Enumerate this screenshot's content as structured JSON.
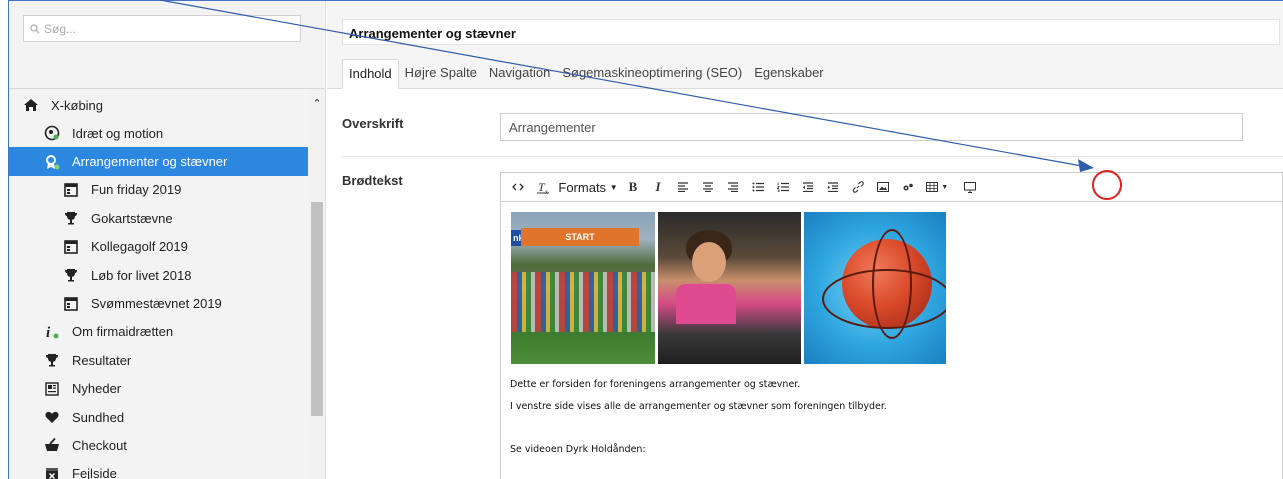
{
  "search": {
    "placeholder": "Søg..."
  },
  "tree": [
    {
      "label": "X-købing",
      "icon": "home-icon"
    },
    {
      "label": "Idræt og motion",
      "icon": "target-icon"
    },
    {
      "label": "Arrangementer og stævner",
      "icon": "award-icon",
      "selected": true
    },
    {
      "label": "Fun friday 2019",
      "icon": "calendar-icon"
    },
    {
      "label": "Gokartstævne",
      "icon": "trophy-icon"
    },
    {
      "label": "Kollegagolf 2019",
      "icon": "calendar-icon"
    },
    {
      "label": "Løb for livet 2018",
      "icon": "trophy-icon"
    },
    {
      "label": "Svømmestævnet 2019",
      "icon": "calendar-icon"
    },
    {
      "label": "Om firmaidrætten",
      "icon": "info-icon"
    },
    {
      "label": "Resultater",
      "icon": "trophy-icon"
    },
    {
      "label": "Nyheder",
      "icon": "newspaper-icon"
    },
    {
      "label": "Sundhed",
      "icon": "heart-icon"
    },
    {
      "label": "Checkout",
      "icon": "cart-icon"
    },
    {
      "label": "Fejlside",
      "icon": "error-icon"
    }
  ],
  "page": {
    "title": "Arrangementer og stævner"
  },
  "tabs": [
    "Indhold",
    "Højre Spalte",
    "Navigation",
    "Søgemaskineoptimering (SEO)",
    "Egenskaber"
  ],
  "fields": {
    "overskrift_label": "Overskrift",
    "overskrift_value": "Arrangementer",
    "brodtekst_label": "Brødtekst"
  },
  "toolbar": {
    "formats_label": "Formats",
    "bold": "B",
    "italic": "I"
  },
  "photos": {
    "banner_text": "START",
    "banner_left": "nk"
  },
  "body_text": [
    "Dette er forsiden for foreningens arrangementer og stævner.",
    "I venstre side vises alle de arrangementer og stævner som foreningen tilbyder.",
    "Se videoen Dyrk Holdånden:"
  ],
  "colors": {
    "selected_bg": "#2b87e0",
    "annotation": "#e02020",
    "arrow": "#2f5da8"
  }
}
